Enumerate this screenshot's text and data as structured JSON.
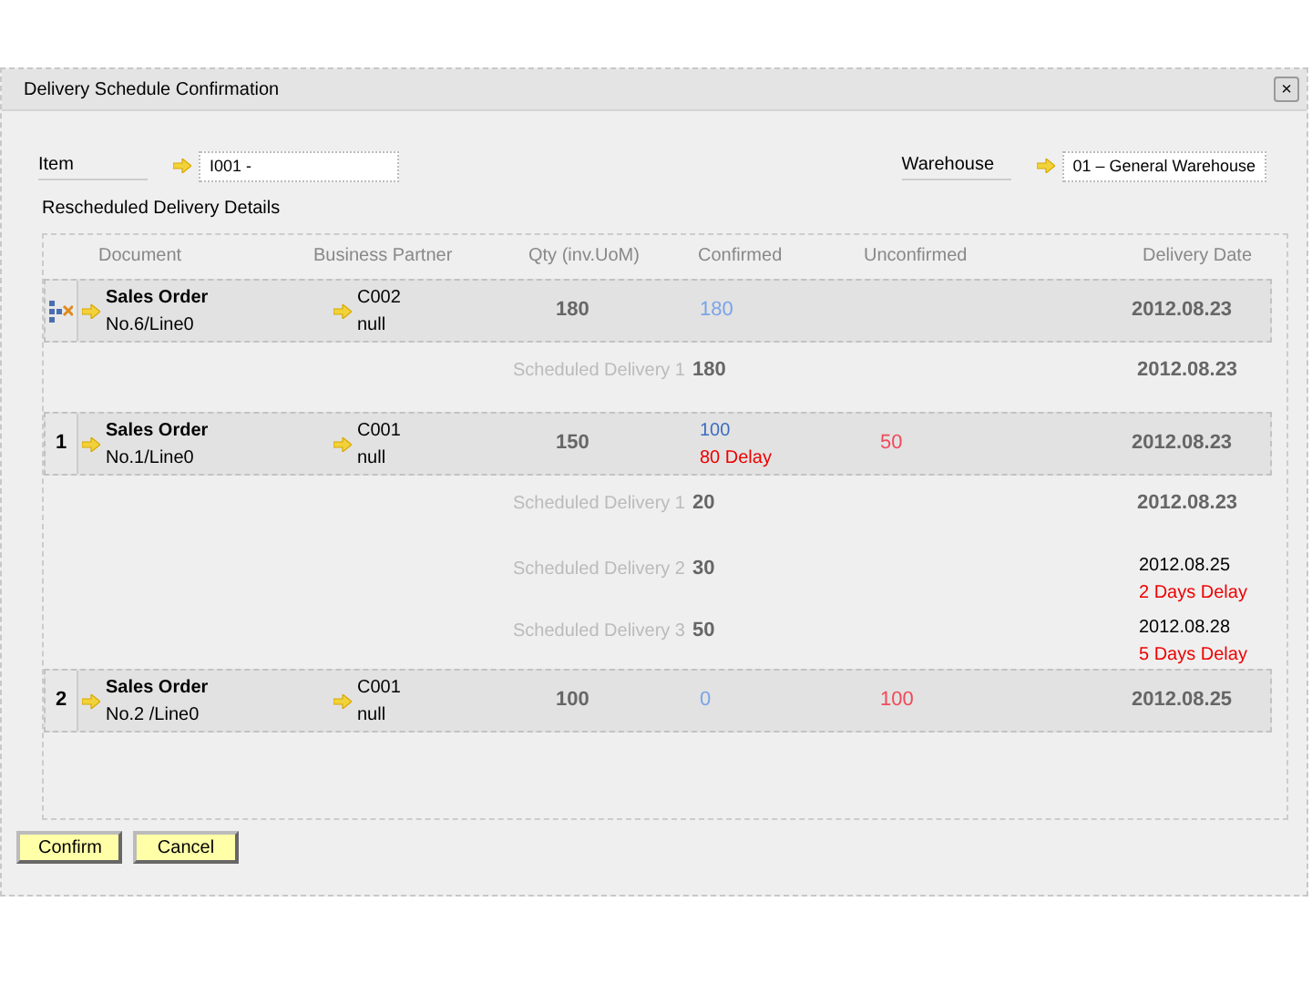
{
  "window": {
    "title": "Delivery Schedule Confirmation",
    "close": "×"
  },
  "item": {
    "label": "Item",
    "value": "I001 -"
  },
  "warehouse": {
    "label": "Warehouse",
    "value": "01 – General Warehouse"
  },
  "section_title": "Rescheduled Delivery Details",
  "columns": [
    "Document",
    "Business Partner",
    "Qty (inv.UoM)",
    "Confirmed",
    "Unconfirmed",
    "Delivery Date"
  ],
  "rows": [
    {
      "header": {
        "kind": "icon"
      },
      "document": {
        "type": "Sales Order",
        "number": "No.6/Line0"
      },
      "partner": {
        "code": "C002",
        "name": "null"
      },
      "qty": "180",
      "confirmed": "180",
      "date": "2012.08.23",
      "schedules": [
        {
          "label": "Scheduled Delivery 1",
          "qty": "180",
          "date": "2012.08.23"
        }
      ]
    },
    {
      "header": {
        "kind": "number",
        "text": "1"
      },
      "document": {
        "type": "Sales Order",
        "number": "No.1/Line0"
      },
      "partner": {
        "code": "C001",
        "name": "null"
      },
      "qty": "150",
      "confirmed": "100",
      "confirmed_delay": "80 Delay",
      "unconfirmed": "50",
      "date": "2012.08.23",
      "schedules": [
        {
          "label": "Scheduled Delivery 1",
          "qty": "20",
          "date": "2012.08.23"
        },
        {
          "label": "Scheduled Delivery 2",
          "qty": "30",
          "date": "2012.08.25",
          "delay": "2 Days Delay"
        },
        {
          "label": "Scheduled Delivery 3",
          "qty": "50",
          "date": "2012.08.28",
          "delay": "5 Days Delay"
        }
      ]
    },
    {
      "header": {
        "kind": "number",
        "text": "2"
      },
      "document": {
        "type": "Sales Order",
        "number": "No.2 /Line0"
      },
      "partner": {
        "code": "C001",
        "name": "null"
      },
      "qty": "100",
      "confirmed": "0",
      "unconfirmed": "100",
      "date": "2012.08.25",
      "schedules": []
    }
  ],
  "buttons": [
    "Confirm",
    "Cancel"
  ]
}
